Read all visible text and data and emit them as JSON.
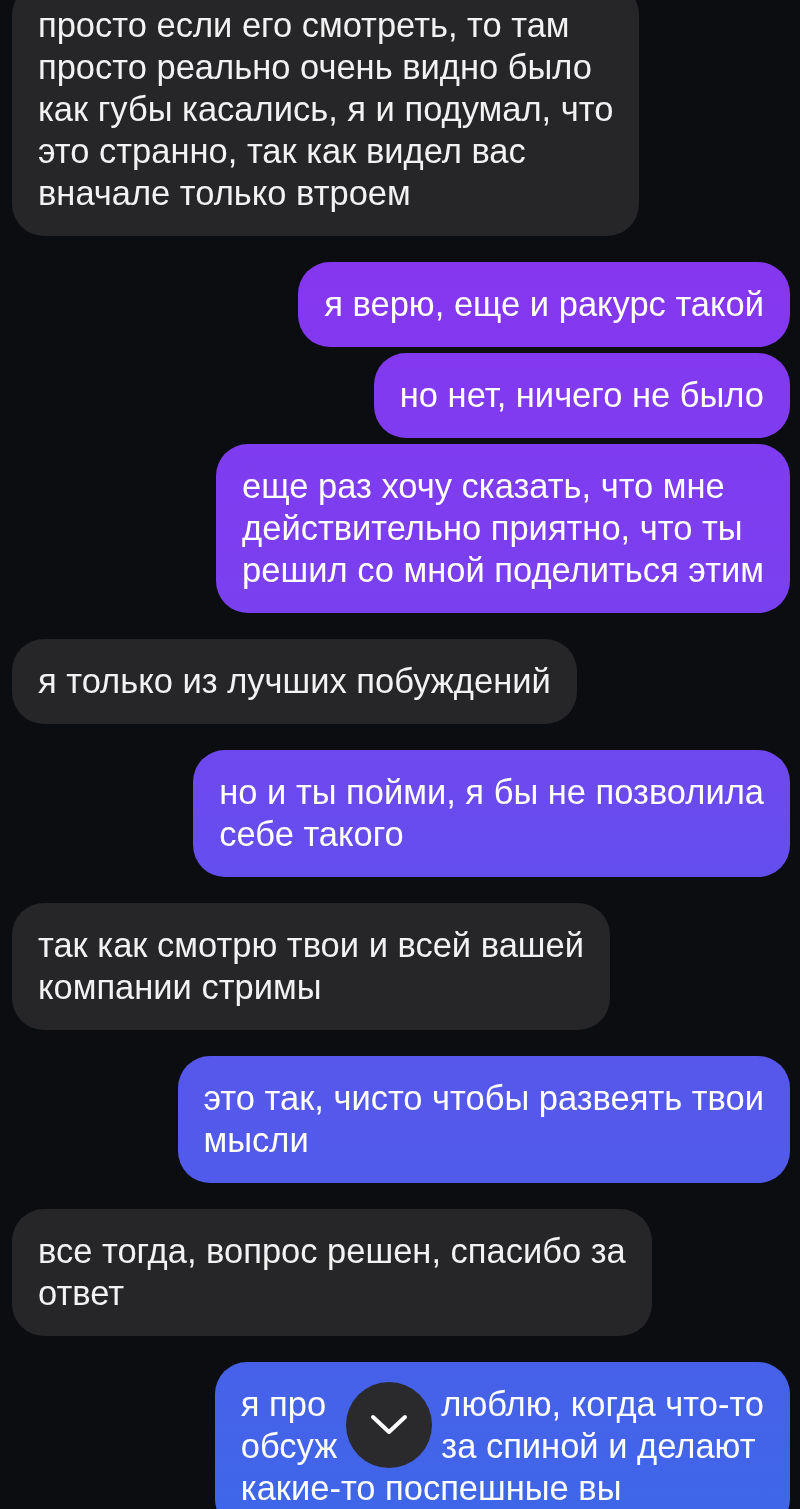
{
  "messages": [
    {
      "kind": "incoming",
      "lines": [
        [
          "просто если его смотреть, то там"
        ],
        [
          "просто реально очень видно было"
        ],
        [
          "как губы касались, я и подумал, что"
        ],
        [
          "это странно, так как видел вас"
        ],
        [
          "вначале только втроем"
        ]
      ]
    },
    {
      "kind": "outgoing",
      "lines": [
        [
          "я верю, еще и ракурс такой"
        ]
      ]
    },
    {
      "kind": "outgoing",
      "lines": [
        [
          "но нет, ничего не было"
        ]
      ]
    },
    {
      "kind": "outgoing",
      "lines": [
        [
          "еще раз хочу сказать, что мне"
        ],
        [
          "действительно приятно, что ты"
        ],
        [
          "решил со мной поделиться этим"
        ]
      ]
    },
    {
      "kind": "incoming",
      "lines": [
        [
          "я только из лучших побуждений"
        ]
      ]
    },
    {
      "kind": "outgoing",
      "lines": [
        [
          "но и ты пойми, я бы не позволила"
        ],
        [
          "себе такого"
        ]
      ]
    },
    {
      "kind": "incoming",
      "lines": [
        [
          "так как смотрю твои и всей вашей"
        ],
        [
          "компании стримы"
        ]
      ]
    },
    {
      "kind": "outgoing",
      "lines": [
        [
          "это так, чисто чтобы развеять твои"
        ],
        [
          "мысли"
        ]
      ]
    },
    {
      "kind": "incoming",
      "lines": [
        [
          "все тогда, вопрос решен, спасибо за"
        ],
        [
          "ответ"
        ]
      ]
    },
    {
      "kind": "outgoing",
      "lines": [
        [
          "я про",
          "люблю, когда что-то"
        ],
        [
          "обсуж",
          "за спиной и делают"
        ],
        [
          "какие-то поспешные вы"
        ]
      ],
      "scroll_button": true
    }
  ]
}
